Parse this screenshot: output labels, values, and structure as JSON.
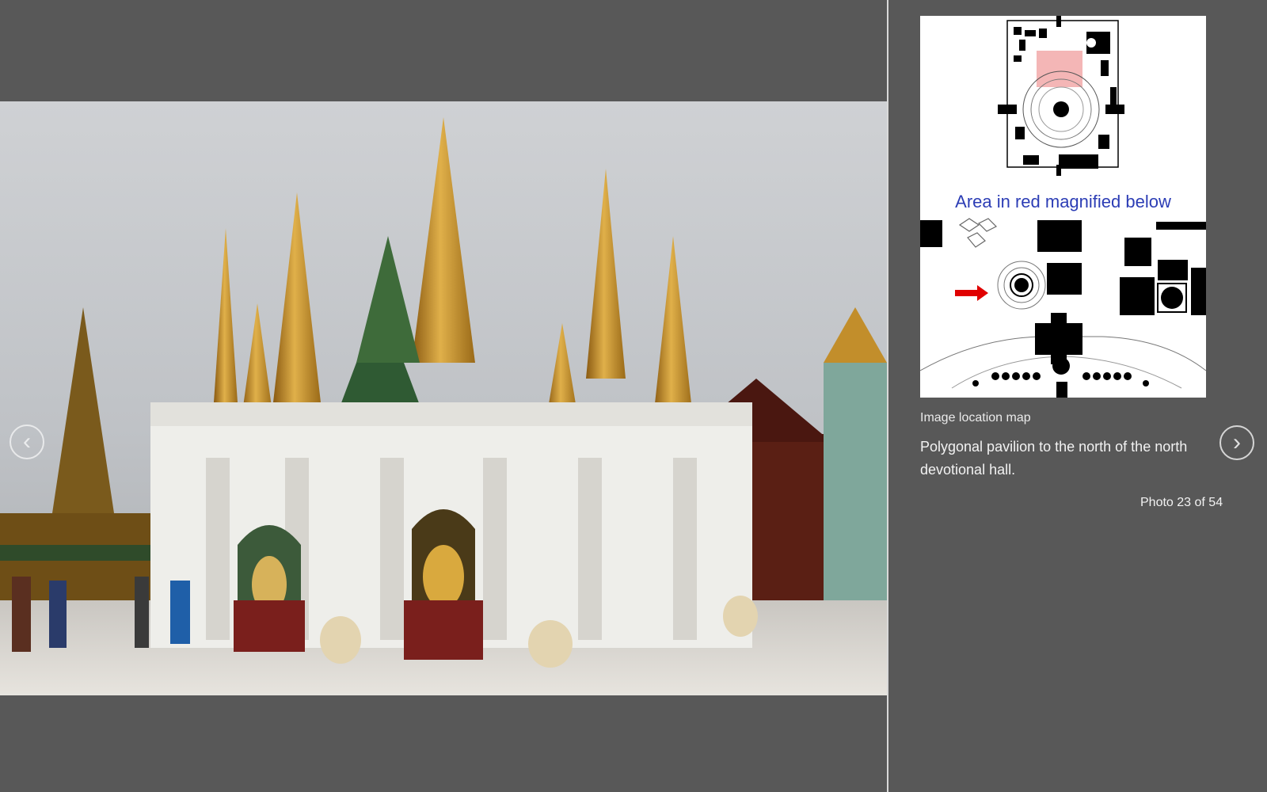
{
  "viewer": {
    "photo_alt": "Shwedagon Pagoda polygonal pavilion",
    "prev_glyph": "‹",
    "next_glyph": "›"
  },
  "sidebar": {
    "map": {
      "annotation": "Area in red magnified below",
      "highlight_color": "#f4b6b6",
      "arrow_color": "#e00000"
    },
    "map_label": "Image location map",
    "caption": "Polygonal pavilion to the north of the north devotional hall.",
    "counter": "Photo 23 of 54"
  },
  "colors": {
    "background": "#585858",
    "annotation_text": "#2c3db5"
  }
}
